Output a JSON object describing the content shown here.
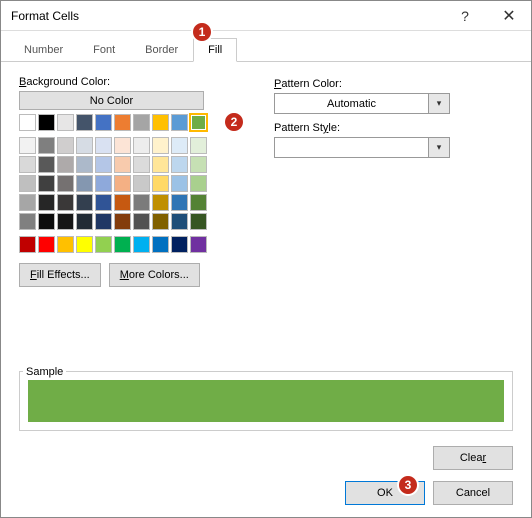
{
  "title": "Format Cells",
  "tabs": {
    "number": "Number",
    "font": "Font",
    "border": "Border",
    "fill": "Fill"
  },
  "labels": {
    "bg_color": "Background Color:",
    "pattern_color": "Pattern Color:",
    "pattern_style": "Pattern Style:",
    "sample": "Sample"
  },
  "buttons": {
    "no_color": "No Color",
    "fill_effects": "Fill Effects...",
    "more_colors": "More Colors...",
    "clear": "Clear",
    "ok": "OK",
    "cancel": "Cancel"
  },
  "pattern_color_value": "Automatic",
  "pattern_style_value": "",
  "selected_color": "#70ad47",
  "badges": {
    "b1": "1",
    "b2": "2",
    "b3": "3"
  },
  "theme_row1": [
    "#ffffff",
    "#000000",
    "#e7e6e6",
    "#44546a",
    "#4472c4",
    "#ed7d31",
    "#a5a5a5",
    "#ffc000",
    "#5b9bd5",
    "#70ad47"
  ],
  "tint_rows": [
    [
      "#f2f2f2",
      "#7f7f7f",
      "#d0cece",
      "#d6dce4",
      "#d9e1f2",
      "#fce4d6",
      "#ededed",
      "#fff2cc",
      "#ddebf7",
      "#e2efda"
    ],
    [
      "#d9d9d9",
      "#595959",
      "#aeaaaa",
      "#acb9ca",
      "#b4c6e7",
      "#f8cbad",
      "#dbdbdb",
      "#ffe699",
      "#bdd7ee",
      "#c6e0b4"
    ],
    [
      "#bfbfbf",
      "#404040",
      "#757171",
      "#8497b0",
      "#8ea9db",
      "#f4b084",
      "#c9c9c9",
      "#ffd966",
      "#9bc2e6",
      "#a9d08e"
    ],
    [
      "#a6a6a6",
      "#262626",
      "#3a3838",
      "#333f4f",
      "#305496",
      "#c65911",
      "#7b7b7b",
      "#bf8f00",
      "#2f75b5",
      "#548235"
    ],
    [
      "#808080",
      "#0d0d0d",
      "#161616",
      "#222b35",
      "#203764",
      "#833c0c",
      "#525252",
      "#806000",
      "#1f4e78",
      "#375623"
    ]
  ],
  "standard_row": [
    "#c00000",
    "#ff0000",
    "#ffc000",
    "#ffff00",
    "#92d050",
    "#00b050",
    "#00b0f0",
    "#0070c0",
    "#002060",
    "#7030a0"
  ],
  "chart_data": null
}
